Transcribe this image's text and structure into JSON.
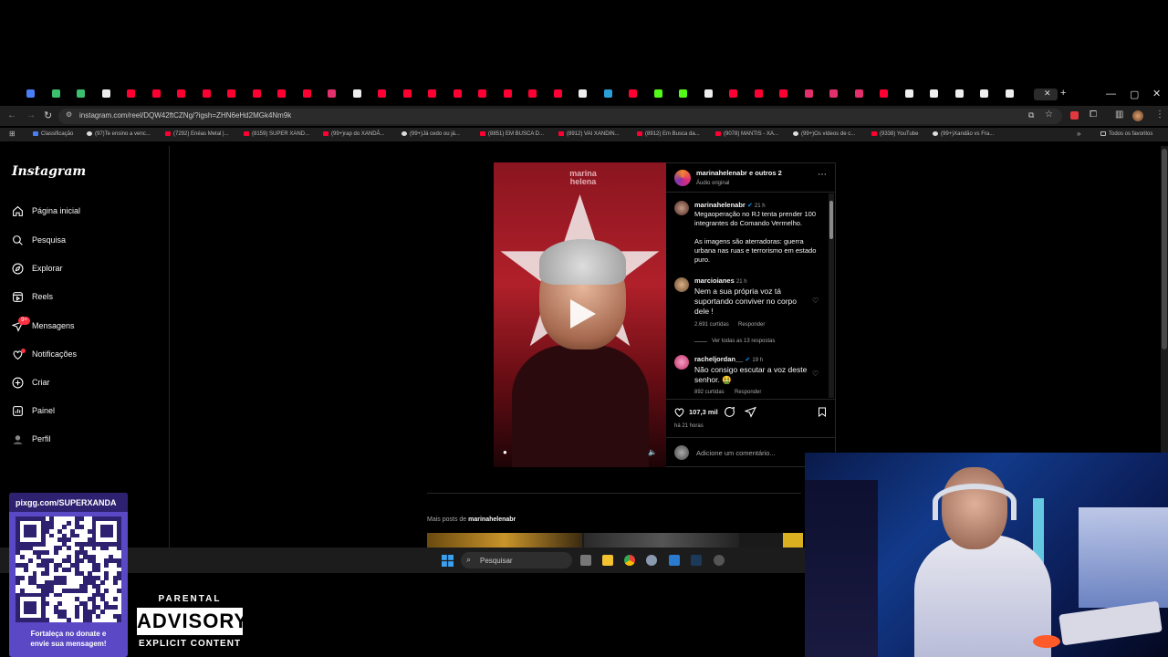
{
  "browser": {
    "url": "instagram.com/reel/DQW42ftCZNg/?igsh=ZHN6eHd2MGk4Nm9k",
    "bookmarks": [
      "Classificação",
      "(97)Te ensino a venc...",
      "(7292) Enéas Metal |...",
      "(8159) SUPER XAND...",
      "(99+)rap do XANDÃ...",
      "(99+)Já cedo ou já...",
      "(8851) EM BUSCA D...",
      "(8912) VAI XANDIN...",
      "(8912) Em Busca da...",
      "(9078) MANTIS - XA...",
      "(99+)Os vídeos de c...",
      "(9338) YouTube",
      "(99+)Xandão vs Fra...",
      "Todos os favoritos"
    ]
  },
  "sidebar": {
    "logo": "Instagram",
    "items": [
      {
        "label": "Página inicial",
        "icon": "home-icon"
      },
      {
        "label": "Pesquisa",
        "icon": "search-icon"
      },
      {
        "label": "Explorar",
        "icon": "compass-icon"
      },
      {
        "label": "Reels",
        "icon": "reels-icon"
      },
      {
        "label": "Mensagens",
        "icon": "messenger-icon"
      },
      {
        "label": "Notificações",
        "icon": "heart-icon"
      },
      {
        "label": "Criar",
        "icon": "plus-icon"
      },
      {
        "label": "Painel",
        "icon": "dashboard-icon"
      },
      {
        "label": "Perfil",
        "icon": "avatar-icon"
      }
    ],
    "messages_badge": "9+"
  },
  "post": {
    "header_user": "marinahelenabr e outros 2",
    "audio": "Áudio original",
    "video_brand": "marina helena",
    "caption_user": "marinahelenabr",
    "caption_time": "21 h",
    "caption_p1": "Megaoperação no RJ tenta prender 100 integrantes do Comando Vermelho.",
    "caption_p2": "As imagens são aterradoras: guerra urbana nas ruas e terrorismo em estado puro.",
    "comments": [
      {
        "user": "marcioianes",
        "time": "21 h",
        "text": "Nem a sua própria voz tá suportando conviver no corpo dele !",
        "likes": "2.691 curtidas",
        "reply": "Responder",
        "view_replies": "Ver todas as 13 respostas"
      },
      {
        "user": "racheljordan__",
        "time": "19 h",
        "text": "Não consigo escutar a voz deste senhor. 🤮",
        "likes": "892 curtidas",
        "reply": "Responder"
      }
    ],
    "like_count": "107,3 mil",
    "posted_ago": "há 21 horas",
    "comment_placeholder": "Adicione um comentário...",
    "more_posts_label": "Mais posts de",
    "more_posts_user": "marinahelenabr"
  },
  "taskbar": {
    "search_placeholder": "Pesquisar"
  },
  "overlay": {
    "qr_url": "pixgg.com/SUPERXANDA",
    "qr_caption_1": "Fortaleça no donate e",
    "qr_caption_2": "envie sua mensagem!",
    "parental_1": "PARENTAL",
    "parental_2": "ADVISORY",
    "parental_3": "EXPLICIT CONTENT"
  },
  "colors": {
    "notification_red": "#ff3040",
    "verified_blue": "#0095f6",
    "qr_purple": "#5a48c4"
  }
}
